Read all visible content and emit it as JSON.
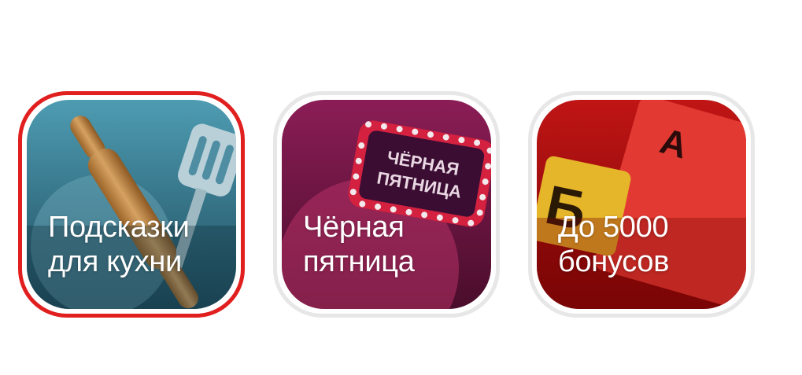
{
  "stories": [
    {
      "id": "kitchen",
      "title_line1": "Подсказки",
      "title_line2": "для кухни",
      "selected": true,
      "icon": "rolling-pin-and-spatula",
      "colors": {
        "bg_top": "#4a97ad",
        "bg_bottom": "#1d4a5b",
        "ring": "#e11f1f"
      }
    },
    {
      "id": "black-friday",
      "title_line1": "Чёрная",
      "title_line2": "пятница",
      "selected": false,
      "icon": "marquee-sign",
      "sign_line1": "ЧЁРНАЯ",
      "sign_line2": "ПЯТНИЦА",
      "colors": {
        "bg_top": "#8a1d55",
        "bg_bottom": "#4b0f2c",
        "ring": "#e7e7e7"
      }
    },
    {
      "id": "bonuses",
      "title_line1": "До 5000",
      "title_line2": "бонусов",
      "selected": false,
      "icon": "letter-cards",
      "card_letter_red": "А",
      "card_letter_yellow": "Б",
      "colors": {
        "bg_top": "#c11414",
        "bg_bottom": "#7c0505",
        "ring": "#e7e7e7"
      }
    }
  ]
}
